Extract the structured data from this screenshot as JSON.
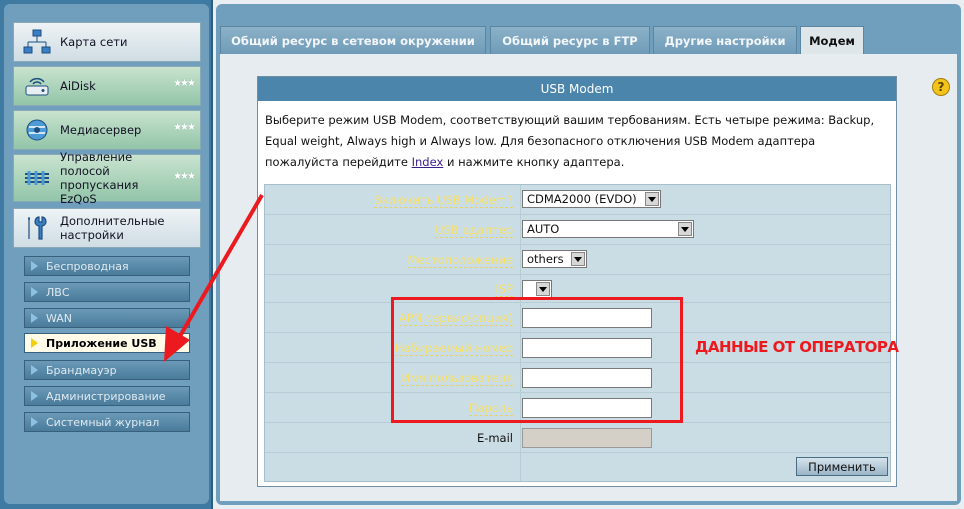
{
  "sidebar": {
    "items": [
      {
        "label": "Карта сети",
        "icon": "network-map-icon"
      },
      {
        "label": "AiDisk",
        "icon": "aidisk-icon"
      },
      {
        "label": "Медиасервер",
        "icon": "media-server-icon"
      },
      {
        "label": "Управление полосой пропускания EzQoS",
        "icon": "qos-icon"
      },
      {
        "label": "Дополнительные настройки",
        "icon": "tools-icon"
      }
    ],
    "subitems": [
      "Беспроводная",
      "ЛВС",
      "WAN",
      "Приложение USB",
      "Брандмауэр",
      "Администрирование",
      "Системный журнал"
    ],
    "active_subitem": "Приложение USB"
  },
  "tabs": [
    "Общий ресурс в сетевом окружении",
    "Общий ресурс в FTP",
    "Другие настройки",
    "Модем"
  ],
  "active_tab": "Модем",
  "modem": {
    "title": "USB Modem",
    "description_1": "Выберите режим USB Modem, соответствующий вашим тербованиям. Есть четыре режима: Backup, Equal weight, Always high и Always low. Для безопасного отключения USB Modem адаптера пожалуйста перейдите ",
    "index_link": "Index",
    "description_2": " и нажмите кнопку адаптера.",
    "fields": {
      "enable_label": "Включить USB Modem?",
      "enable_value": "CDMA2000 (EVDO)",
      "adapter_label": "USB адаптер",
      "adapter_value": "AUTO",
      "location_label": "Местоположение",
      "location_value": "others",
      "isp_label": "ISP",
      "isp_value": "",
      "apn_label": "APN сервис(опция)",
      "dial_label": "Набираемый номер",
      "user_label": "Имя пользователя",
      "password_label": "Пароль",
      "email_label": "E-mail"
    },
    "apply_label": "Применить"
  },
  "annotation": {
    "text": "ДАННЫЕ ОТ ОПЕРАТОРА",
    "color": "#ec1a1f"
  },
  "help_icon": "?"
}
